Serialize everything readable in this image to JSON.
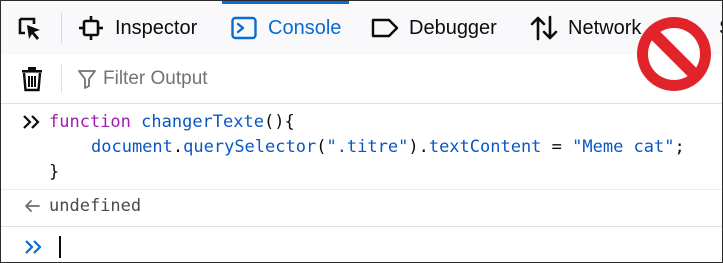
{
  "toolbar": {
    "tabs": [
      {
        "label": "Inspector",
        "icon": "inspector-icon",
        "active": false
      },
      {
        "label": "Console",
        "icon": "console-icon",
        "active": true
      },
      {
        "label": "Debugger",
        "icon": "debugger-icon",
        "active": false
      },
      {
        "label": "Network",
        "icon": "network-icon",
        "active": false
      },
      {
        "label": "S",
        "icon": "style-editor-icon",
        "active": false
      }
    ]
  },
  "filter": {
    "placeholder": "Filter Output"
  },
  "console": {
    "code": {
      "line1_kw": "function",
      "line1_name": "changerTexte",
      "line1_rest": "(){",
      "line2_obj": "document",
      "line2_dot1": ".",
      "line2_method": "querySelector",
      "line2_open": "(",
      "line2_arg": "\".titre\"",
      "line2_close": ").",
      "line2_prop": "textContent",
      "line2_eq": " = ",
      "line2_val": "\"Meme cat\"",
      "line2_semi": ";",
      "line3": "}"
    },
    "result": "undefined"
  },
  "colors": {
    "accent": "#0a6bd3",
    "keyword": "#a21caf",
    "identifier": "#0b57c2",
    "prohibition_red": "#e0242a"
  }
}
